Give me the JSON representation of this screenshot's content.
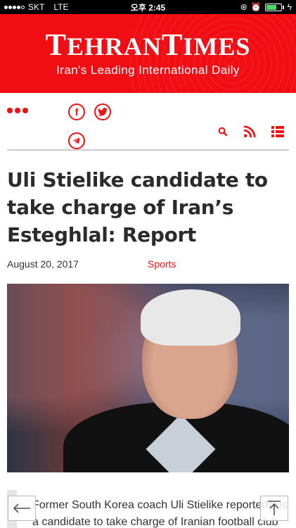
{
  "status": {
    "carrier": "SKT",
    "network": "LTE",
    "time": "오후 2:45"
  },
  "masthead": {
    "brand_first": "T",
    "brand_rest1": "EHRAN",
    "brand_second": "T",
    "brand_rest2": "IMES",
    "tagline": "Iran's Leading International Daily"
  },
  "toolbar": {
    "more": "more-dots",
    "facebook": "f",
    "twitter": "twitter-bird",
    "telegram": "telegram-plane"
  },
  "article": {
    "headline": "Uli Stielike candidate to take charge of Iran’s Esteghlal: Report",
    "date": "August 20, 2017",
    "category": "Sports",
    "lead": "Former South Korea coach Uli Stielike reportedly is a candidate to take charge of Iranian football club"
  },
  "colors": {
    "brand": "#f10d14",
    "accent": "#e11111"
  }
}
